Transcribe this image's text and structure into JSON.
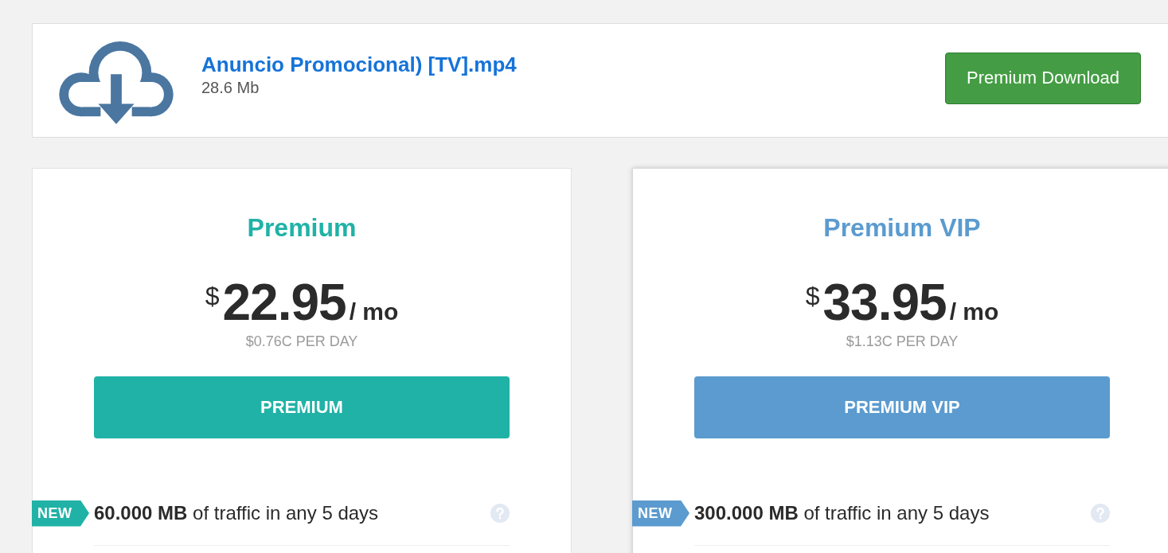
{
  "file": {
    "name": "Anuncio Promocional) [TV].mp4",
    "size": "28.6 Mb",
    "download_button": "Premium Download"
  },
  "plans": [
    {
      "name": "Premium",
      "color": "#20b2a6",
      "featured": false,
      "currency": "$",
      "price": "22.95",
      "period": "/ mo",
      "per_day": "$0.76C PER DAY",
      "button": "PREMIUM",
      "features": [
        {
          "badge": "NEW",
          "text": "**60.000 MB** of traffic in any 5 days"
        }
      ]
    },
    {
      "name": "Premium VIP",
      "color": "#5b9bcf",
      "featured": true,
      "currency": "$",
      "price": "33.95",
      "period": "/ mo",
      "per_day": "$1.13C PER DAY",
      "button": "PREMIUM VIP",
      "features": [
        {
          "badge": "NEW",
          "text": "**300.000 MB** of traffic in any 5 days"
        }
      ]
    }
  ]
}
